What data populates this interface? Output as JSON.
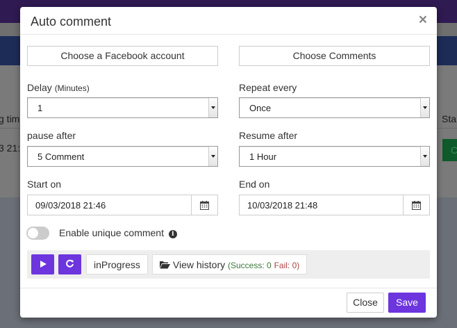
{
  "background": {
    "col_left_header": "g tim",
    "col_left_value": "3 21:4",
    "col_right_header": "Sta",
    "col_right_button": "C"
  },
  "modal": {
    "title": "Auto comment",
    "close_symbol": "×",
    "choose_account_label": "Choose a Facebook account",
    "choose_comments_label": "Choose Comments",
    "delay": {
      "label": "Delay",
      "unit": "(Minutes)",
      "value": "1"
    },
    "repeat": {
      "label": "Repeat every",
      "value": "Once"
    },
    "pause": {
      "label": "pause after",
      "value": "5 Comment"
    },
    "resume": {
      "label": "Resume after",
      "value": "1 Hour"
    },
    "start": {
      "label": "Start on",
      "value": "09/03/2018 21:46"
    },
    "end": {
      "label": "End on",
      "value": "10/03/2018 21:48"
    },
    "unique_comment_label": "Enable unique comment",
    "unique_comment_enabled": false,
    "status_label": "inProgress",
    "history_label": "View history",
    "success_text": "Success: 0",
    "fail_text": "Fail: 0",
    "close_label": "Close",
    "save_label": "Save"
  },
  "colors": {
    "accent": "#6c35de"
  }
}
